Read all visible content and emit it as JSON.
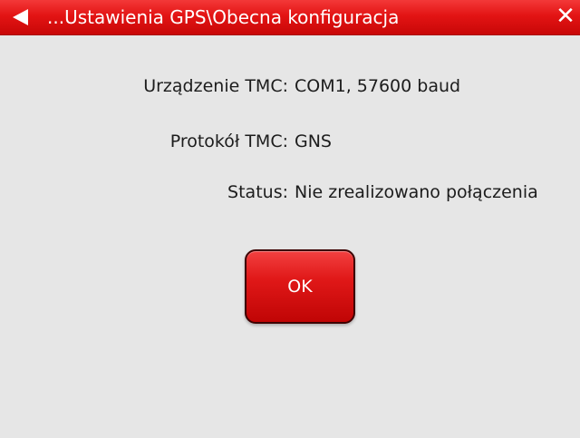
{
  "window": {
    "title": "...Ustawienia GPS\\Obecna konfiguracja",
    "back_icon": "back-arrow-icon",
    "close_icon": "close-icon",
    "close_glyph": "✕"
  },
  "config": {
    "rows": [
      {
        "label": "Urządzenie TMC:",
        "value": "COM1, 57600 baud"
      },
      {
        "label": "Protokół TMC:",
        "value": "GNS"
      },
      {
        "label": "Status:",
        "value": "Nie zrealizowano połączenia"
      }
    ]
  },
  "actions": {
    "ok_label": "OK"
  },
  "colors": {
    "accent": "#e31414",
    "background": "#e6e6e6",
    "text": "#1c1c1c"
  }
}
